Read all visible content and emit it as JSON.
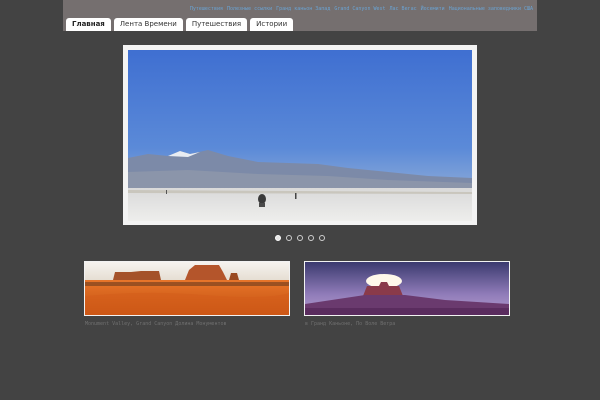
{
  "top_links": [
    "Путешествия",
    "Полезные ссылки",
    "Гранд каньон Запад",
    "Grand Canyon West",
    "Лас Вегас",
    "Йосемити",
    "Национальные заповедники США"
  ],
  "tabs": [
    {
      "label": "Главная",
      "active": true
    },
    {
      "label": "Лента Времени",
      "active": false
    },
    {
      "label": "Путешествия",
      "active": false
    },
    {
      "label": "Истории",
      "active": false
    }
  ],
  "slider": {
    "slide_count": 5,
    "active_index": 0
  },
  "thumbnails": [
    {
      "caption": "Monument Valley, Grand Canyon Долина Монументов"
    },
    {
      "caption": "в Гранд Каньоне, По Воле Ветра"
    }
  ],
  "colors": {
    "background": "#434343",
    "header": "#756f6f",
    "link": "#6aa3d3"
  }
}
